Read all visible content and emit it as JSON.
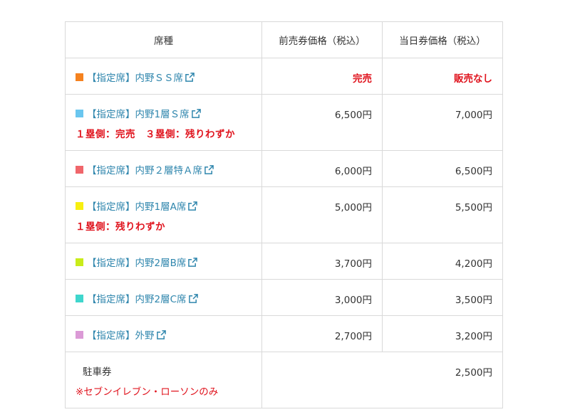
{
  "header": {
    "seat": "席種",
    "advance": "前売券価格（税込）",
    "day": "当日券価格（税込）"
  },
  "rows": [
    {
      "label": "【指定席】内野ＳＳ席",
      "color": "#f5821f",
      "advance": "完売",
      "day": "販売なし",
      "note": ""
    },
    {
      "label": "【指定席】内野1層Ｓ席",
      "color": "#6ac6ef",
      "advance": "6,500円",
      "day": "7,000円",
      "note": "１塁側：完売　３塁側：残りわずか"
    },
    {
      "label": "【指定席】内野２層特Ａ席",
      "color": "#f0666b",
      "advance": "6,000円",
      "day": "6,500円",
      "note": ""
    },
    {
      "label": "【指定席】内野1層A席",
      "color": "#f7ef10",
      "advance": "5,000円",
      "day": "5,500円",
      "note": "１塁側：残りわずか"
    },
    {
      "label": "【指定席】内野2層B席",
      "color": "#c9ec1a",
      "advance": "3,700円",
      "day": "4,200円",
      "note": ""
    },
    {
      "label": "【指定席】内野2層C席",
      "color": "#3fd6cd",
      "advance": "3,000円",
      "day": "3,500円",
      "note": ""
    },
    {
      "label": "【指定席】外野",
      "color": "#db9ad6",
      "advance": "2,700円",
      "day": "3,200円",
      "note": ""
    }
  ],
  "parking": {
    "label": "駐車券",
    "note": "※セブンイレブン・ローソンのみ",
    "price": "2,500円"
  },
  "colors": {
    "link": "#2f86ad",
    "alert": "#e0141e",
    "border": "#d9d9d9"
  },
  "icons": {
    "external": "external-link-icon"
  }
}
